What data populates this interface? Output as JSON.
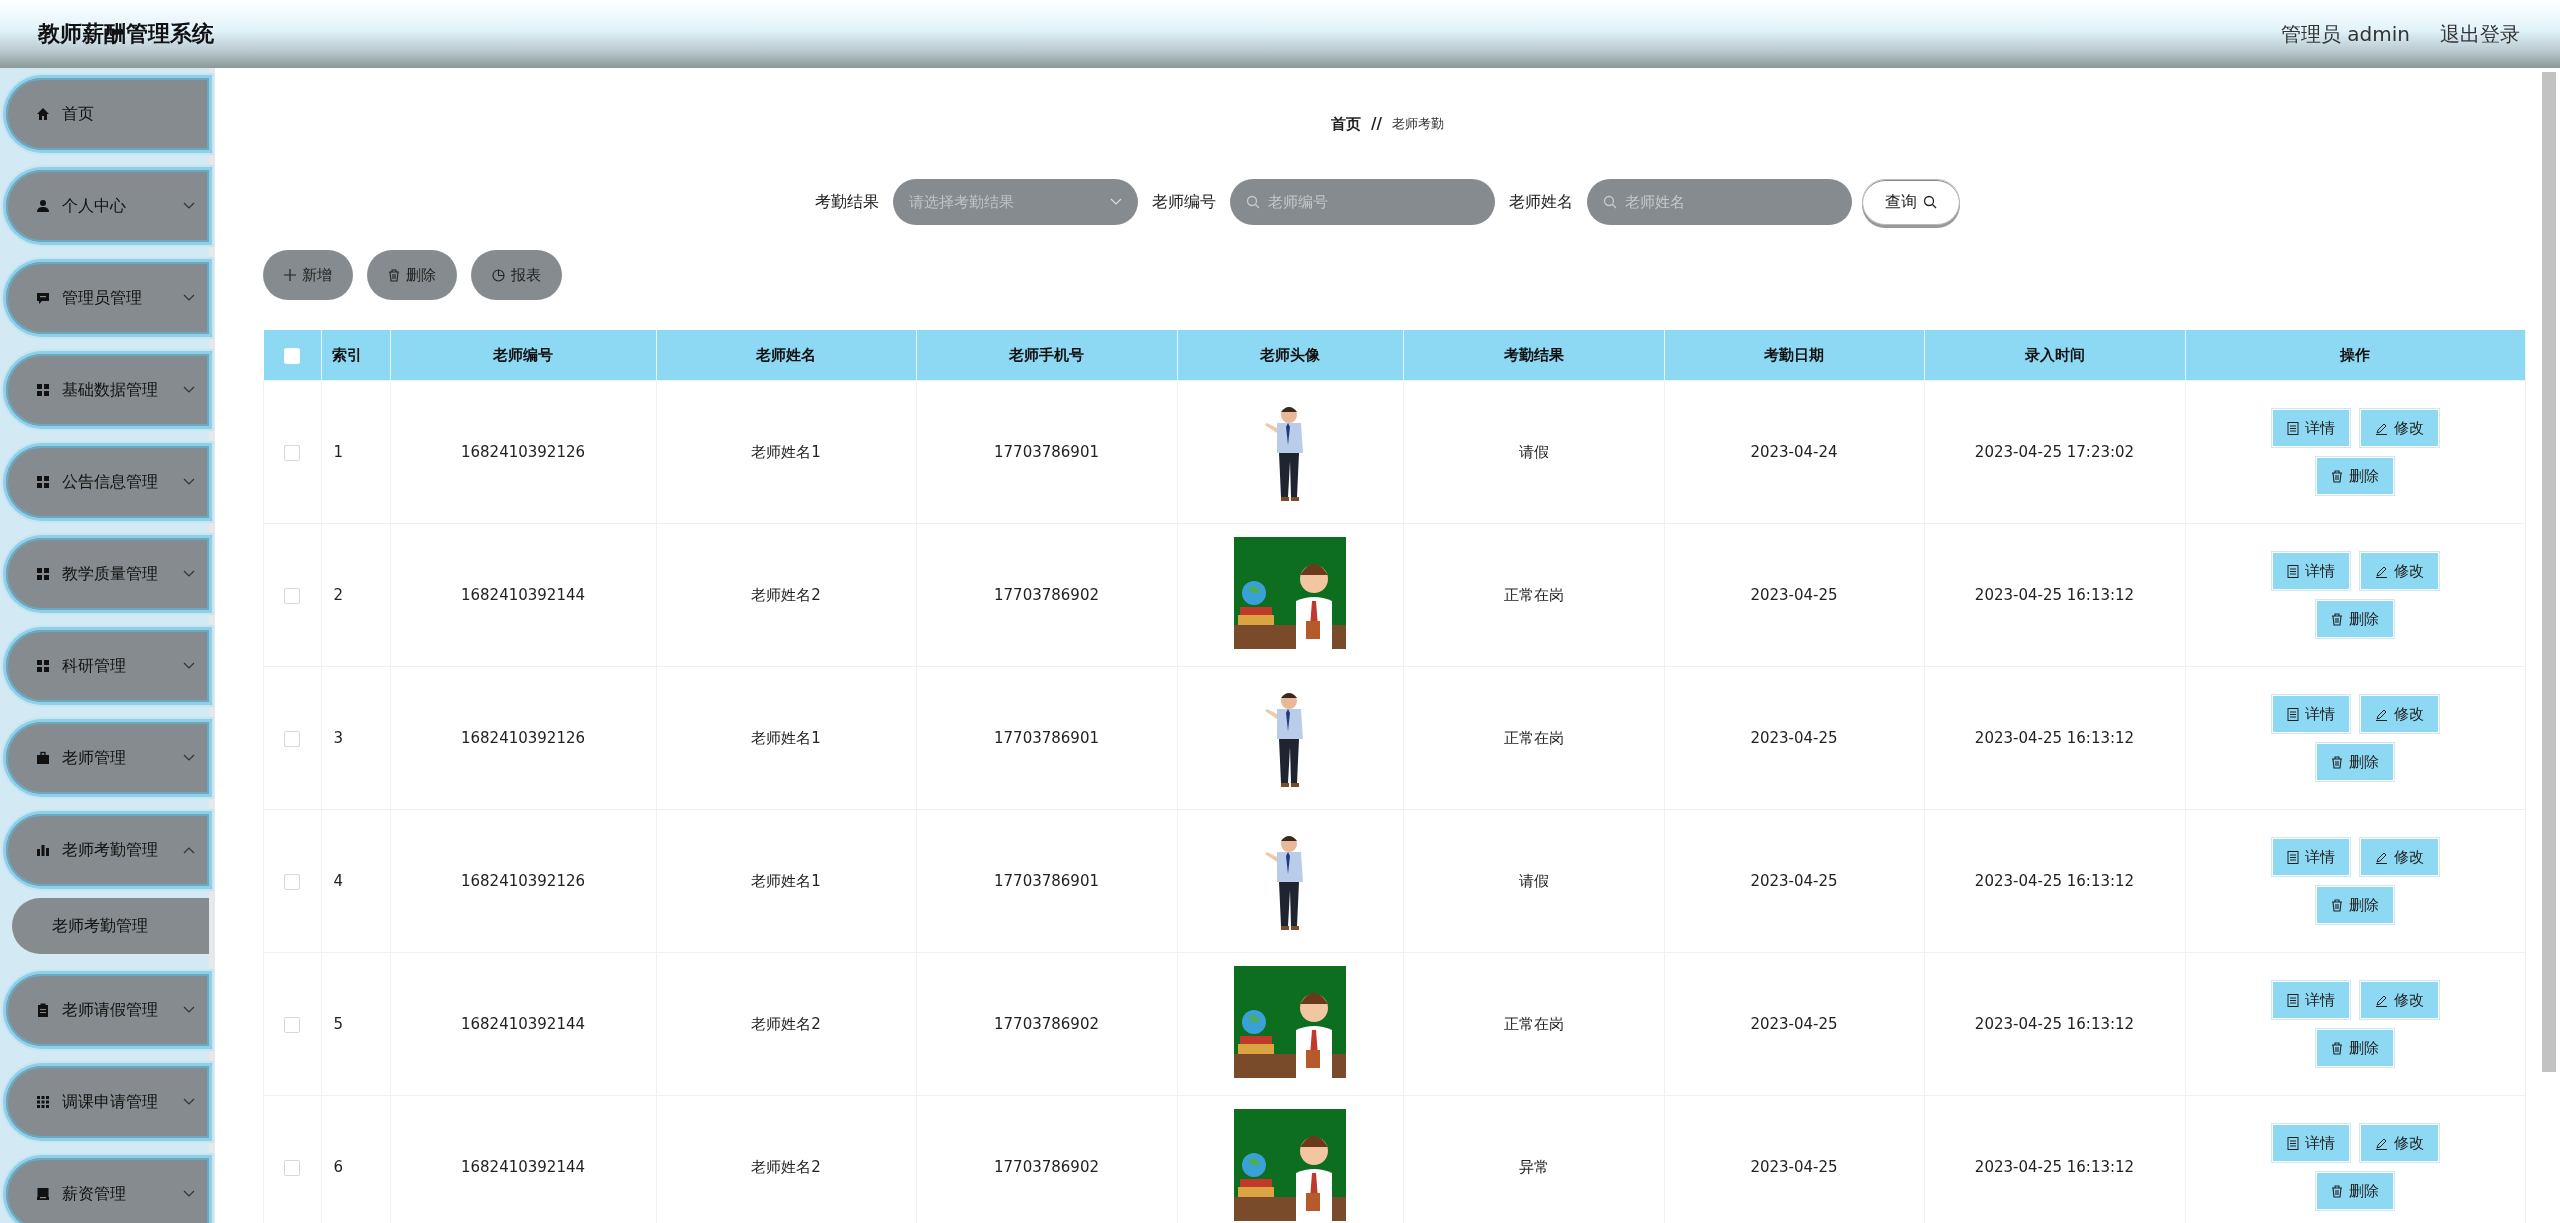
{
  "header": {
    "title": "教师薪酬管理系统",
    "user": "管理员 admin",
    "logout": "退出登录"
  },
  "sidebar": {
    "items": [
      {
        "label": "首页"
      },
      {
        "label": "个人中心",
        "expanded": false
      },
      {
        "label": "管理员管理",
        "expanded": false
      },
      {
        "label": "基础数据管理",
        "expanded": false
      },
      {
        "label": "公告信息管理",
        "expanded": false
      },
      {
        "label": "教学质量管理",
        "expanded": false
      },
      {
        "label": "科研管理",
        "expanded": false
      },
      {
        "label": "老师管理",
        "expanded": false
      },
      {
        "label": "老师考勤管理",
        "expanded": true,
        "children": [
          {
            "label": "老师考勤管理"
          }
        ]
      },
      {
        "label": "老师请假管理",
        "expanded": false
      },
      {
        "label": "调课申请管理",
        "expanded": false
      },
      {
        "label": "薪资管理",
        "expanded": false
      }
    ]
  },
  "breadcrumb": {
    "home": "首页",
    "separator": "//",
    "current": "老师考勤"
  },
  "filters": [
    {
      "kind": "select",
      "label": "考勤结果",
      "placeholder": "请选择考勤结果"
    },
    {
      "kind": "search",
      "label": "老师编号",
      "placeholder": "老师编号"
    },
    {
      "kind": "search",
      "label": "老师姓名",
      "placeholder": "老师姓名"
    }
  ],
  "search_button": "查询",
  "actions": [
    "新增",
    "删除",
    "报表"
  ],
  "table": {
    "all_checked": false,
    "columns": [
      "索引",
      "老师编号",
      "老师姓名",
      "老师手机号",
      "老师头像",
      "考勤结果",
      "考勤日期",
      "录入时间",
      "操作"
    ],
    "rows": [
      {
        "checked": false,
        "index": "1",
        "id": "1682410392126",
        "name": "老师姓名1",
        "phone": "17703786901",
        "result": "请假",
        "date": "2023-04-24",
        "created": "2023-04-25 17:23:02",
        "actions": [
          "详情",
          "修改",
          "删除"
        ]
      },
      {
        "checked": false,
        "index": "2",
        "id": "1682410392144",
        "name": "老师姓名2",
        "phone": "17703786902",
        "result": "正常在岗",
        "date": "2023-04-25",
        "created": "2023-04-25 16:13:12",
        "actions": [
          "详情",
          "修改",
          "删除"
        ]
      },
      {
        "checked": false,
        "index": "3",
        "id": "1682410392126",
        "name": "老师姓名1",
        "phone": "17703786901",
        "result": "正常在岗",
        "date": "2023-04-25",
        "created": "2023-04-25 16:13:12",
        "actions": [
          "详情",
          "修改",
          "删除"
        ]
      },
      {
        "checked": false,
        "index": "4",
        "id": "1682410392126",
        "name": "老师姓名1",
        "phone": "17703786901",
        "result": "请假",
        "date": "2023-04-25",
        "created": "2023-04-25 16:13:12",
        "actions": [
          "详情",
          "修改",
          "删除"
        ]
      },
      {
        "checked": false,
        "index": "5",
        "id": "1682410392144",
        "name": "老师姓名2",
        "phone": "17703786902",
        "result": "正常在岗",
        "date": "2023-04-25",
        "created": "2023-04-25 16:13:12",
        "actions": [
          "详情",
          "修改",
          "删除"
        ]
      },
      {
        "checked": false,
        "index": "6",
        "id": "1682410392144",
        "name": "老师姓名2",
        "phone": "17703786902",
        "result": "异常",
        "date": "2023-04-25",
        "created": "2023-04-25 16:13:12",
        "actions": [
          "详情",
          "修改",
          "删除"
        ]
      }
    ]
  }
}
